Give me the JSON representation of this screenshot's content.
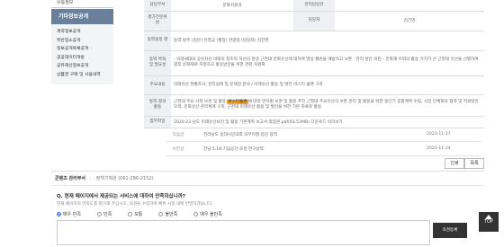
{
  "sidebar": {
    "top_label": "유통정보",
    "active_label": "기타정보공개",
    "items": [
      {
        "label": "계약정보공개",
        "arrow": false
      },
      {
        "label": "위반업소공개",
        "arrow": false
      },
      {
        "label": "정보공개목록공개",
        "arrow": true
      },
      {
        "label": "공공데이터개방",
        "arrow": false
      },
      {
        "label": "공유재산정보공개",
        "arrow": false
      },
      {
        "label": "상품권 구매 및 사용내역",
        "arrow": false
      }
    ]
  },
  "table": {
    "row1": {
      "th1": "담당부서",
      "v1": "문화지원과",
      "th2": "관리담당관",
      "v2": ""
    },
    "row2": {
      "th1": "평가전문위원",
      "v1": "",
      "th2": "담당자",
      "v2": "김진영"
    },
    "row3": {
      "th": "동역실정 명",
      "val": "동역 방주 (김문) 유영금 (월장) 관광일 (담당자) 김진영"
    },
    "row4": {
      "th": "동역 목적 및 필요성",
      "val": "- 미래세대의 공유자산 미래의 창조적 자산의 발굴 근현대 문화유산에 대하여 멸실 훼손을 예방하고 보존 · 관리 방안 마련 - 문화재 이외의 활용 가치가 큰 근현대 유산을 선별하여 향후 문화재로 지정하고 활용방안을 위한 관련 자원화"
    },
    "row5": {
      "th": "주요내용",
      "val": "미래유산 현황조사, 관리실태 및 문제점 분석 / 미래유산 활용 및 발전 마스터 플랜 구축"
    },
    "row6": {
      "th": "동역 결과 활용",
      "val_before": "근현대 주요 사적 보존 및 활용 ",
      "highlight": "마스터플랜",
      "val_after": "에 따라 연차별 보존 및 활용 추진 근현대 주요유산의 보존 관리 및 활용을 위한 중단기 종합계획 수립, 시민 단체와의 협력 및 지원방안 모색, 문화유산 관리체계 구축, 근현대 미래유산 활용 및 발전을 위한 기본 자료로 활용"
    },
    "row7": {
      "th": "첨부파일",
      "val": "2020-23 남도 미래유산보전 및 활용 기본계획 보고서 최종본.pdf(93.52MB) 다운로드 미리보기"
    }
  },
  "history": [
    {
      "label": "다음글",
      "text": "전라남도 용대시민의회 의무이행 점검 용역",
      "date": "2023-11-27"
    },
    {
      "label": "이전글",
      "text": "전남 5.18 기념공간 조성 연구용역",
      "date": "2023-11-24"
    }
  ],
  "buttons": {
    "print": "인쇄",
    "list": "목록",
    "submit": "의견등록",
    "top": "TOP"
  },
  "survey": {
    "org_label": "콘텐츠 관리부서",
    "dept": "정책기획관 (061-286-2152)",
    "question": "Q. 현재 페이지에서 제공되는 서비스에 대하여 만족하십니까?",
    "sub": "현재 페이지의 만족도를 평가해 주십시오. 의견을 수렴하여 빠른 시일 내에 반영하겠습니다.",
    "options": [
      "매우 만족",
      "만족",
      "보통",
      "불만족",
      "매우 불만족"
    ],
    "selected_index": 0
  },
  "colors": {
    "sidebar_active": "#6a7f9a",
    "highlight": "#f5a623",
    "dark": "#333333",
    "radio_on": "#2d6bd1"
  }
}
